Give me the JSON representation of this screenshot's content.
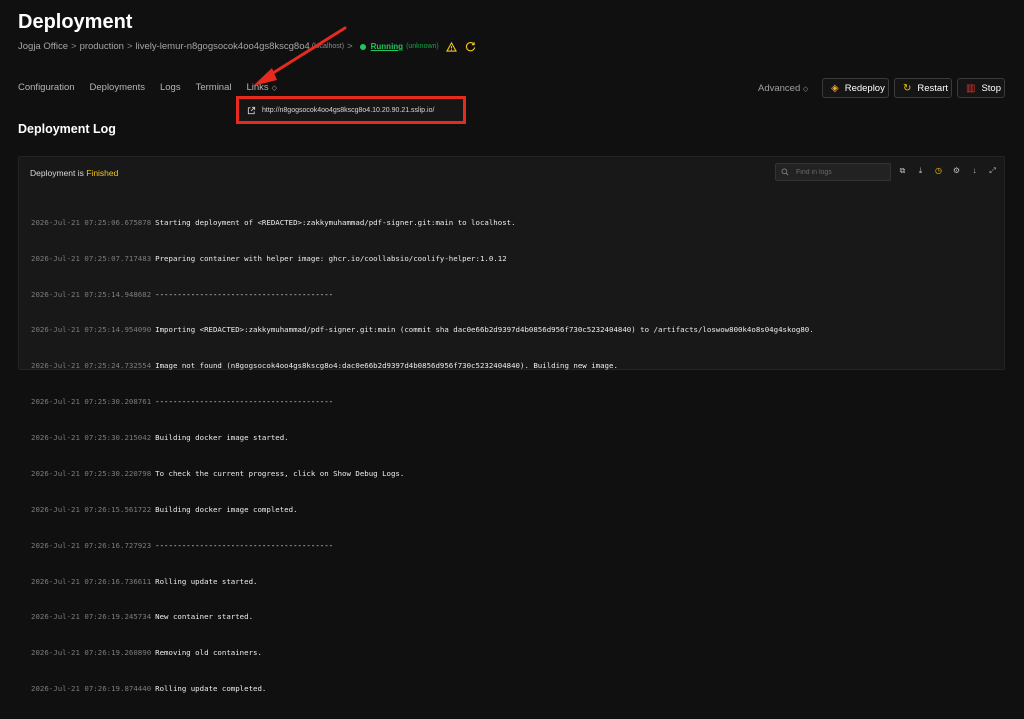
{
  "page": {
    "title": "Deployment"
  },
  "breadcrumb": {
    "team": "Jogja Office",
    "environment": "production",
    "resource": "lively-lemur-n8gogsocok4oo4gs8kscg8o4",
    "server": "(localhost)",
    "status": "Running",
    "status_detail": "(unknown)",
    "separator": ">"
  },
  "tabs": [
    {
      "label": "Configuration"
    },
    {
      "label": "Deployments"
    },
    {
      "label": "Logs"
    },
    {
      "label": "Terminal"
    },
    {
      "label": "Links"
    }
  ],
  "actions": {
    "advanced_label": "Advanced",
    "redeploy_label": "Redeploy",
    "restart_label": "Restart",
    "stop_label": "Stop"
  },
  "links_dropdown": {
    "url": "http://n8gogsocok4oo4gs8kscg8o4.10.20.90.21.sslip.io/"
  },
  "section": {
    "title": "Deployment Log"
  },
  "log": {
    "status_prefix": "Deployment is",
    "status_value": "Finished",
    "search_placeholder": "Find in logs",
    "lines": [
      {
        "ts": "2026-Jul-21 07:25:06.675878",
        "msg": "Starting deployment of <REDACTED>:zakkymuhammad/pdf-signer.git:main to localhost."
      },
      {
        "ts": "2026-Jul-21 07:25:07.717483",
        "msg": "Preparing container with helper image: ghcr.io/coollabsio/coolify-helper:1.0.12"
      },
      {
        "ts": "2026-Jul-21 07:25:14.948682",
        "msg": "----------------------------------------"
      },
      {
        "ts": "2026-Jul-21 07:25:14.954090",
        "msg": "Importing <REDACTED>:zakkymuhammad/pdf-signer.git:main (commit sha dac0e66b2d9397d4b0856d956f730c5232404840) to /artifacts/loswow800k4o8s04g4skog80."
      },
      {
        "ts": "2026-Jul-21 07:25:24.732554",
        "msg": "Image not found (n8gogsocok4oo4gs8kscg8o4:dac0e66b2d9397d4b0856d956f730c5232404840). Building new image."
      },
      {
        "ts": "2026-Jul-21 07:25:30.208761",
        "msg": "----------------------------------------"
      },
      {
        "ts": "2026-Jul-21 07:25:30.215042",
        "msg": "Building docker image started."
      },
      {
        "ts": "2026-Jul-21 07:25:30.220798",
        "msg": "To check the current progress, click on Show Debug Logs."
      },
      {
        "ts": "2026-Jul-21 07:26:15.561722",
        "msg": "Building docker image completed."
      },
      {
        "ts": "2026-Jul-21 07:26:16.727923",
        "msg": "----------------------------------------"
      },
      {
        "ts": "2026-Jul-21 07:26:16.736611",
        "msg": "Rolling update started."
      },
      {
        "ts": "2026-Jul-21 07:26:19.245734",
        "msg": "New container started."
      },
      {
        "ts": "2026-Jul-21 07:26:19.260890",
        "msg": "Removing old containers."
      },
      {
        "ts": "2026-Jul-21 07:26:19.874440",
        "msg": "Rolling update completed."
      }
    ]
  },
  "colors": {
    "accent_running": "#22c55e",
    "finished": "#f5c518",
    "annotation_red": "#e42b1d"
  }
}
